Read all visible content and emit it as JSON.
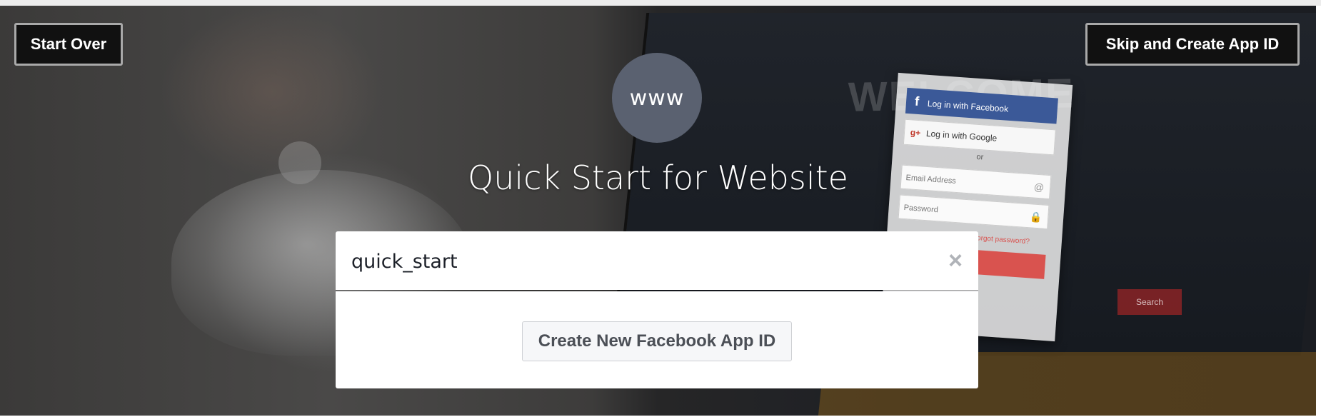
{
  "header": {
    "start_over_label": "Start Over",
    "skip_label": "Skip and Create App ID"
  },
  "hero": {
    "platform_icon_text": "www",
    "title": "Quick Start for Website"
  },
  "search": {
    "value": "quick_start",
    "clear_icon": "×"
  },
  "dropdown": {
    "create_button_label": "Create New Facebook App ID"
  },
  "background_card": {
    "fb_login": "Log in with Facebook",
    "google_login": "Log in with Google",
    "or_text": "or",
    "email_placeholder": "Email Address",
    "password_placeholder": "Password",
    "forgot_text": "Forgot password?",
    "search_text": "Search",
    "welcome_text": "WELCOME"
  },
  "colors": {
    "facebook_blue": "#3b5998",
    "circle_bg": "#5a6170",
    "button_text": "#4b4f56"
  },
  "icons": {
    "clear": "close-icon",
    "platform": "www-icon"
  }
}
